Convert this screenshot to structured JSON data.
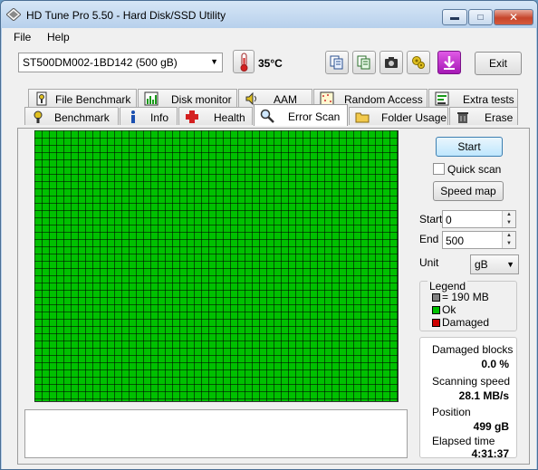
{
  "window": {
    "title": "HD Tune Pro 5.50 - Hard Disk/SSD Utility"
  },
  "menu": {
    "file": "File",
    "help": "Help"
  },
  "toolbar": {
    "drive": "ST500DM002-1BD142 (500 gB)",
    "temperature": "35°C",
    "exit_label": "Exit"
  },
  "tabs_top": [
    {
      "label": "File Benchmark",
      "icon": "file-benchmark-icon"
    },
    {
      "label": "Disk monitor",
      "icon": "disk-monitor-icon"
    },
    {
      "label": "AAM",
      "icon": "speaker-icon"
    },
    {
      "label": "Random Access",
      "icon": "random-access-icon"
    },
    {
      "label": "Extra tests",
      "icon": "extra-tests-icon"
    }
  ],
  "tabs_bottom": [
    {
      "label": "Benchmark",
      "icon": "benchmark-icon"
    },
    {
      "label": "Info",
      "icon": "info-icon"
    },
    {
      "label": "Health",
      "icon": "health-cross-icon"
    },
    {
      "label": "Error Scan",
      "icon": "magnifier-icon",
      "active": true
    },
    {
      "label": "Folder Usage",
      "icon": "folder-icon"
    },
    {
      "label": "Erase",
      "icon": "trash-icon"
    }
  ],
  "scan": {
    "start_button": "Start",
    "quick_scan_label": "Quick scan",
    "quick_scan_checked": false,
    "speed_map_button": "Speed map",
    "start_label": "Start",
    "start_value": "0",
    "end_label": "End",
    "end_value": "500",
    "unit_label": "Unit",
    "unit_value": "gB"
  },
  "legend": {
    "title": "Legend",
    "block_size": "= 190 MB",
    "ok": "Ok",
    "damaged": "Damaged",
    "colors": {
      "block": "#808080",
      "ok": "#00c000",
      "damaged": "#cc0000"
    }
  },
  "stats": {
    "damaged_blocks_label": "Damaged blocks",
    "damaged_blocks_value": "0.0 %",
    "scanning_speed_label": "Scanning speed",
    "scanning_speed_value": "28.1 MB/s",
    "position_label": "Position",
    "position_value": "499 gB",
    "elapsed_label": "Elapsed time",
    "elapsed_value": "4:31:37"
  }
}
